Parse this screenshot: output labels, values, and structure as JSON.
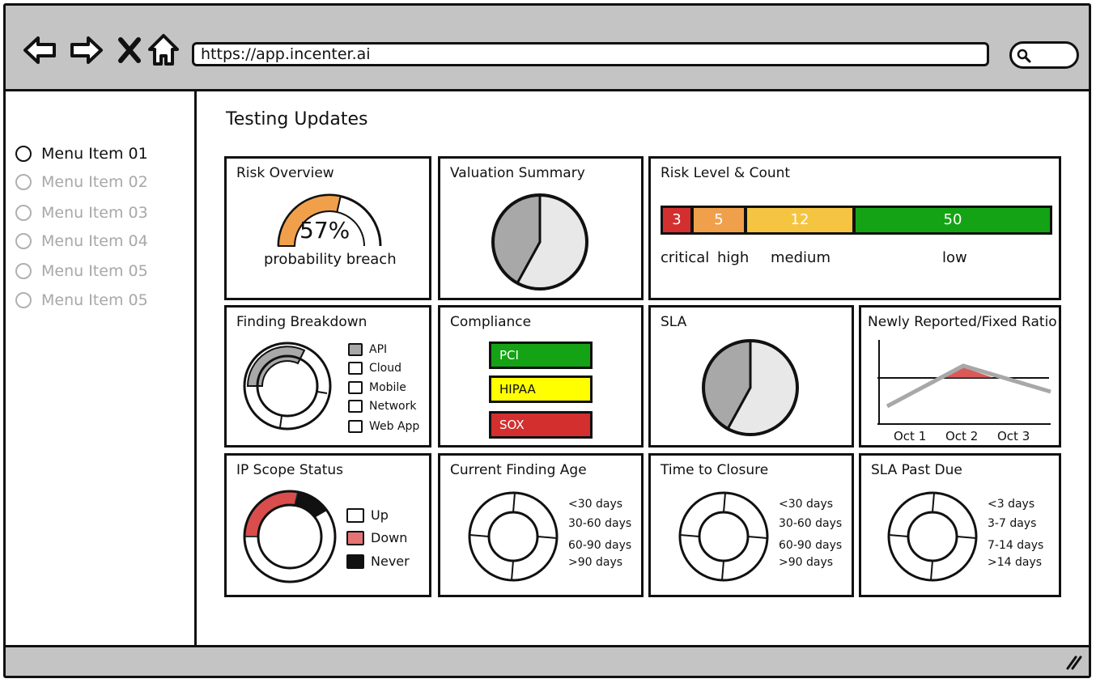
{
  "browser": {
    "url": "https://app.incenter.ai",
    "icons": [
      "back-arrow-icon",
      "forward-arrow-icon",
      "close-icon",
      "home-icon",
      "search-icon",
      "resize-grip-icon"
    ]
  },
  "sidebar": {
    "items": [
      {
        "label": "Menu Item 01",
        "active": true
      },
      {
        "label": "Menu Item 02",
        "active": false
      },
      {
        "label": "Menu Item 03",
        "active": false
      },
      {
        "label": "Menu Item 04",
        "active": false
      },
      {
        "label": "Menu Item 05",
        "active": false
      },
      {
        "label": "Menu Item 05",
        "active": false
      }
    ]
  },
  "page": {
    "title": "Testing Updates"
  },
  "colors": {
    "red": "#d32f2f",
    "orange": "#f0a04b",
    "yellow": "#f5c542",
    "green": "#14a314",
    "gray": "#a8a8a8",
    "light": "#e8e8e8",
    "compYellow": "#ffff00"
  },
  "cards": {
    "risk_overview": {
      "title": "Risk Overview",
      "value": "57%",
      "caption": "probability breach",
      "percent": 57
    },
    "valuation": {
      "title": "Valuation Summary",
      "dark_fraction": 0.42
    },
    "risk_level": {
      "title": "Risk Level & Count",
      "levels": [
        {
          "label": "critical",
          "count": "3"
        },
        {
          "label": "high",
          "count": "5"
        },
        {
          "label": "medium",
          "count": "12"
        },
        {
          "label": "low",
          "count": "50"
        }
      ]
    },
    "finding_breakdown": {
      "title": "Finding Breakdown",
      "legend": [
        "API",
        "Cloud",
        "Mobile",
        "Network",
        "Web App"
      ]
    },
    "compliance": {
      "title": "Compliance",
      "items": [
        "PCI",
        "HIPAA",
        "SOX"
      ]
    },
    "sla": {
      "title": "SLA",
      "dark_fraction": 0.42
    },
    "ratio": {
      "title": "Newly Reported/Fixed Ratio",
      "x_labels": [
        "Oct 1",
        "Oct 2",
        "Oct 3"
      ]
    },
    "ip_scope": {
      "title": "IP Scope Status",
      "legend": [
        "Up",
        "Down",
        "Never"
      ]
    },
    "finding_age": {
      "title": "Current Finding Age",
      "legend": [
        "<30 days",
        "30-60 days",
        "60-90 days",
        ">90 days"
      ]
    },
    "time_closure": {
      "title": "Time to Closure",
      "legend": [
        "<30 days",
        "30-60 days",
        "60-90 days",
        ">90 days"
      ]
    },
    "sla_past_due": {
      "title": "SLA Past Due",
      "legend": [
        "<3 days",
        "3-7 days",
        "7-14 days",
        ">14 days"
      ]
    }
  }
}
